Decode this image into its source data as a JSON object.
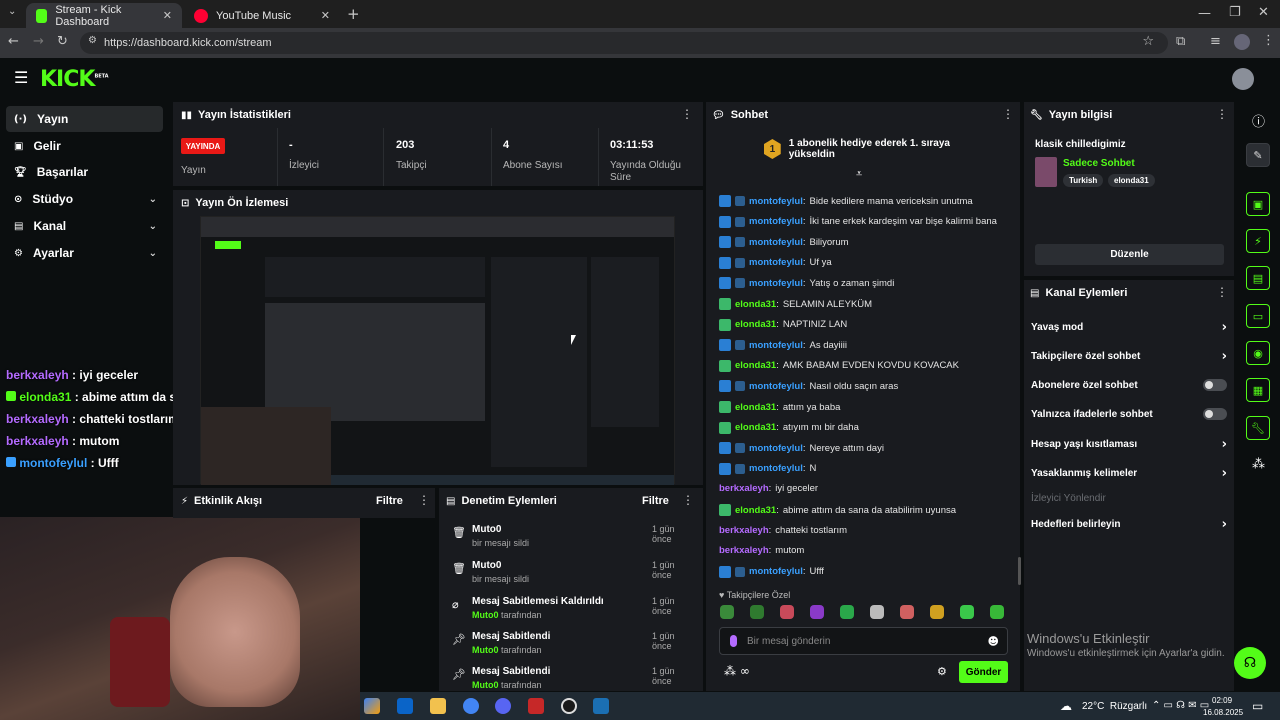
{
  "browser": {
    "tabs": [
      {
        "title": "Stream - Kick Dashboard",
        "active": true
      },
      {
        "title": "YouTube Music",
        "active": false
      }
    ],
    "url": "https://dashboard.kick.com/stream"
  },
  "app": {
    "logo": "KICK",
    "logo_sup": "BETA"
  },
  "nav": [
    {
      "label": "Yayın",
      "icon": "broadcast-icon",
      "active": true
    },
    {
      "label": "Gelir",
      "icon": "income-icon"
    },
    {
      "label": "Başarılar",
      "icon": "trophy-icon"
    },
    {
      "label": "Stüdyo",
      "icon": "studio-icon",
      "expandable": true
    },
    {
      "label": "Kanal",
      "icon": "channel-icon",
      "expandable": true
    },
    {
      "label": "Ayarlar",
      "icon": "gear-icon",
      "expandable": true
    }
  ],
  "overlay_chat": [
    {
      "user": "berkxaleyh",
      "msg": "iyi geceler",
      "color": "#b46bff"
    },
    {
      "user": "elonda31",
      "msg": "abime attım da sana da atabilirim uyunsa",
      "color": "#53fc18"
    },
    {
      "user": "berkxaleyh",
      "msg": "chatteki tostlarım",
      "color": "#b46bff"
    },
    {
      "user": "berkxaleyh",
      "msg": "mutom",
      "color": "#b46bff"
    },
    {
      "user": "montofeylul",
      "msg": "Ufff",
      "color": "#3aa0ff"
    }
  ],
  "stats": {
    "title": "Yayın İstatistikleri",
    "status_badge": "YAYINDA",
    "items": [
      {
        "value": "",
        "label": "Yayın"
      },
      {
        "value": "-",
        "label": "İzleyici"
      },
      {
        "value": "203",
        "label": "Takipçi"
      },
      {
        "value": "4",
        "label": "Abone Sayısı"
      },
      {
        "value": "03:11:53",
        "label": "Yayında Olduğu Süre"
      }
    ]
  },
  "preview": {
    "title": "Yayın Ön İzlemesi"
  },
  "activity": {
    "title": "Etkinlik Akışı",
    "filter": "Filtre"
  },
  "moderation": {
    "title": "Denetim Eylemleri",
    "filter": "Filtre",
    "rows": [
      {
        "title": "Muto0",
        "sub": "bir mesajı sildi",
        "time": "1 gün önce",
        "icon": "trash-icon"
      },
      {
        "title": "Muto0",
        "sub": "bir mesajı sildi",
        "time": "1 gün önce",
        "icon": "trash-icon"
      },
      {
        "title": "Mesaj Sabitlemesi Kaldırıldı",
        "sub_user": "Muto0",
        "sub": "tarafından",
        "time": "1 gün önce",
        "icon": "unpin-icon"
      },
      {
        "title": "Mesaj Sabitlendi",
        "sub_user": "Muto0",
        "sub": "tarafından",
        "time": "1 gün önce",
        "icon": "pin-icon"
      },
      {
        "title": "Mesaj Sabitlendi",
        "sub_user": "Muto0",
        "sub": "tarafından",
        "time": "1 gün önce",
        "icon": "pin-icon"
      }
    ]
  },
  "chat": {
    "title": "Sohbet",
    "pinned_rank": "1",
    "pinned": "1 abonelik hediye ederek 1. sıraya yükseldin",
    "messages": [
      {
        "user": "montofeylul",
        "msg": "Bide kedilere mama vericeksin unutma",
        "color": "#3aa0ff"
      },
      {
        "user": "montofeylul",
        "msg": "İki tane erkek kardeşim var bişe kalirmi bana",
        "color": "#3aa0ff"
      },
      {
        "user": "montofeylul",
        "msg": "Biliyorum",
        "color": "#3aa0ff"
      },
      {
        "user": "montofeylul",
        "msg": "Uf ya",
        "color": "#3aa0ff"
      },
      {
        "user": "montofeylul",
        "msg": "Yatış o zaman şimdi",
        "color": "#3aa0ff"
      },
      {
        "user": "elonda31",
        "msg": "SELAMIN ALEYKÜM",
        "color": "#53fc18"
      },
      {
        "user": "elonda31",
        "msg": "NAPTINIZ LAN",
        "color": "#53fc18"
      },
      {
        "user": "montofeylul",
        "msg": "As dayiiii",
        "color": "#3aa0ff"
      },
      {
        "user": "elonda31",
        "msg": "AMK BABAM EVDEN KOVDU KOVACAK",
        "color": "#53fc18"
      },
      {
        "user": "montofeylul",
        "msg": "Nasıl oldu saçın aras",
        "color": "#3aa0ff"
      },
      {
        "user": "elonda31",
        "msg": "attım ya baba",
        "color": "#53fc18"
      },
      {
        "user": "elonda31",
        "msg": "atıyım mı bir daha",
        "color": "#53fc18"
      },
      {
        "user": "montofeylul",
        "msg": "Nereye attım dayi",
        "color": "#3aa0ff"
      },
      {
        "user": "montofeylul",
        "msg": "N",
        "color": "#3aa0ff"
      },
      {
        "user": "berkxaleyh",
        "msg": "iyi geceler",
        "color": "#b46bff"
      },
      {
        "user": "elonda31",
        "msg": "abime attım da sana da atabilirim uyunsa",
        "color": "#53fc18"
      },
      {
        "user": "berkxaleyh",
        "msg": "chatteki tostlarım",
        "color": "#b46bff"
      },
      {
        "user": "berkxaleyh",
        "msg": "mutom",
        "color": "#b46bff"
      },
      {
        "user": "montofeylul",
        "msg": "Ufff",
        "color": "#3aa0ff"
      }
    ],
    "emote_section": "Takipçilere Özel",
    "input_placeholder": "Bir mesaj gönderin",
    "send": "Gönder"
  },
  "info": {
    "title": "Yayın bilgisi",
    "stream_title": "klasik chilledigimiz",
    "category": "Sadece Sohbet",
    "tags": [
      "Turkish",
      "elonda31"
    ],
    "edit": "Düzenle"
  },
  "actions": {
    "title": "Kanal Eylemleri",
    "rows": [
      {
        "label": "Yavaş mod",
        "kind": "chevron"
      },
      {
        "label": "Takipçilere özel sohbet",
        "kind": "chevron"
      },
      {
        "label": "Abonelere özel sohbet",
        "kind": "toggle"
      },
      {
        "label": "Yalnızca ifadelerle sohbet",
        "kind": "toggle"
      },
      {
        "label": "Hesap yaşı kısıtlaması",
        "kind": "chevron"
      },
      {
        "label": "Yasaklanmış kelimeler",
        "kind": "chevron"
      },
      {
        "label": "İzleyici Yönlendir",
        "kind": "disabled"
      },
      {
        "label": "Hedefleri belirleyin",
        "kind": "chevron"
      }
    ]
  },
  "windows": {
    "activate_title": "Windows'u Etkinleştir",
    "activate_sub": "Windows'u etkinleştirmek için Ayarlar'a gidin.",
    "weather": "22°C  Rüzgarlı",
    "time": "02:09",
    "date": "16.08.2025"
  },
  "colors": {
    "accent": "#53fc18",
    "panel": "#191b1f",
    "live": "#e91916"
  }
}
